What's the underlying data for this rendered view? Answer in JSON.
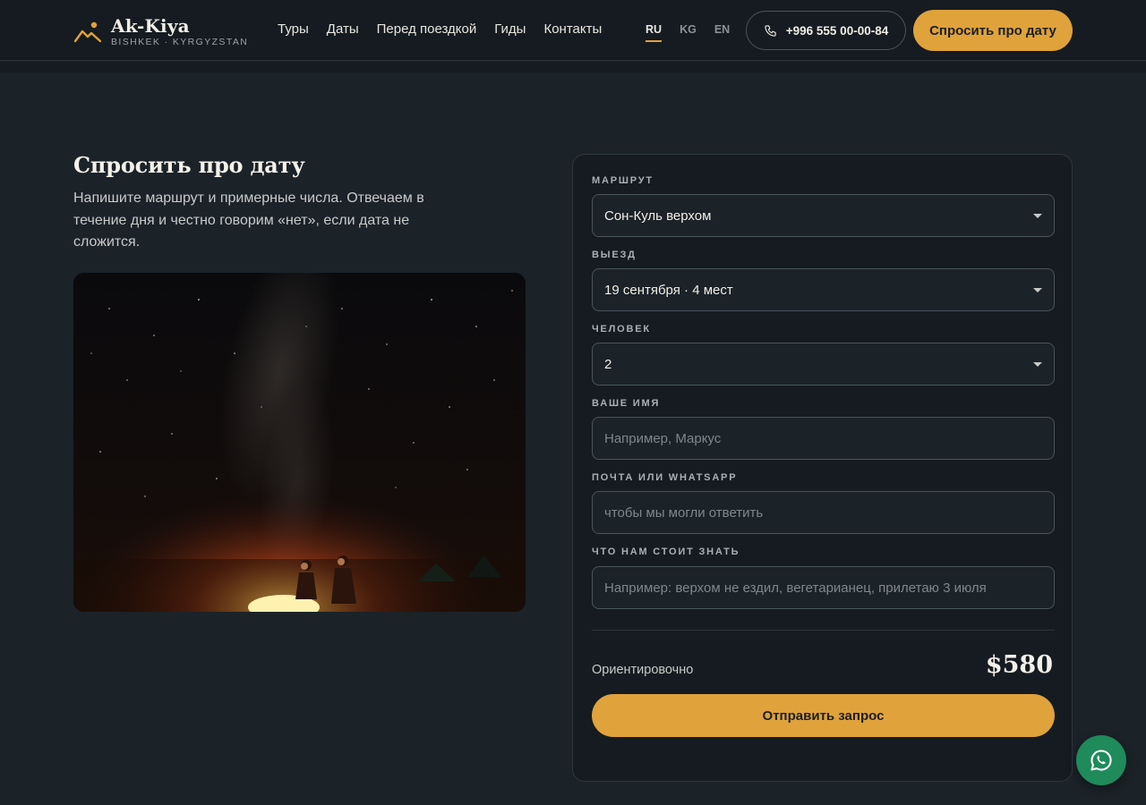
{
  "header": {
    "logo_title": "Ak-Kiya",
    "logo_subtitle": "BISHKEK · KYRGYZSTAN",
    "nav": [
      "Туры",
      "Даты",
      "Перед поездкой",
      "Гиды",
      "Контакты"
    ],
    "languages": [
      "RU",
      "KG",
      "EN"
    ],
    "active_language": "RU",
    "phone": "+996 555 00-00-84",
    "cta_label": "Спросить про дату"
  },
  "intro": {
    "title": "Спросить про дату",
    "description": "Напишите маршрут и примерные числа. Отвечаем в течение дня и честно говорим «нет», если дата не сложится."
  },
  "form": {
    "route": {
      "label": "МАРШРУТ",
      "value": "Сон-Куль верхом"
    },
    "departure": {
      "label": "ВЫЕЗД",
      "value": "19 сентября · 4 мест"
    },
    "people": {
      "label": "ЧЕЛОВЕК",
      "value": "2"
    },
    "name": {
      "label": "ВАШЕ ИМЯ",
      "placeholder": "Например, Маркус"
    },
    "contact": {
      "label": "ПОЧТА ИЛИ WHATSAPP",
      "placeholder": "чтобы мы могли ответить"
    },
    "notes": {
      "label": "ЧТО НАМ СТОИТ ЗНАТЬ",
      "placeholder": "Например: верхом не ездил, вегетарианец, прилетаю 3 июля"
    },
    "estimate_label": "Ориентировочно",
    "estimate_price": "$580",
    "submit_label": "Отправить запрос"
  },
  "colors": {
    "accent": "#e0a23b",
    "background": "#1b2228",
    "header": "#151b20",
    "whatsapp": "#1f8a5a"
  },
  "icons": {
    "logo": "mountain-sun-icon",
    "phone": "phone-icon",
    "whatsapp": "whatsapp-icon",
    "select": "chevron-down-icon"
  }
}
